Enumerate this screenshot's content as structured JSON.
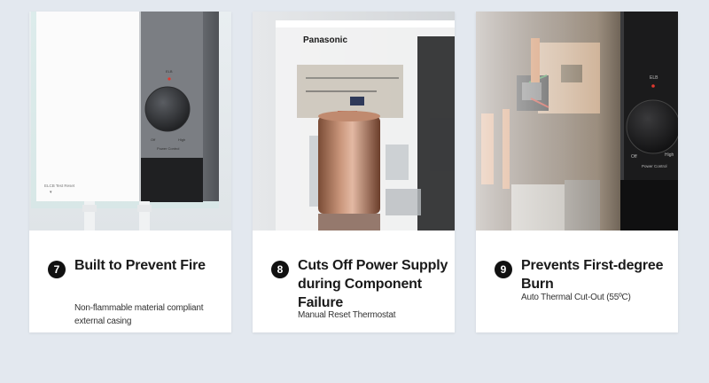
{
  "cards": [
    {
      "number": "7",
      "title": "Built to Prevent Fire",
      "description": "Non-flammable material compliant external casing",
      "image": {
        "label_power_control": "Power Control",
        "label_off": "Off",
        "label_high": "High",
        "label_elcb": "ELCB Test Reset",
        "label_led": "ELB"
      }
    },
    {
      "number": "8",
      "title": "Cuts Off Power Supply during Component Failure",
      "description": "Manual Reset Thermostat",
      "image": {
        "brand": "Panasonic"
      }
    },
    {
      "number": "9",
      "title": "Prevents First-degree Burn",
      "description": "Auto Thermal Cut-Out (55ºC)",
      "image": {
        "label_power_control": "Power Control",
        "label_off": "Off",
        "label_high": "High",
        "label_led": "ELB"
      }
    }
  ]
}
